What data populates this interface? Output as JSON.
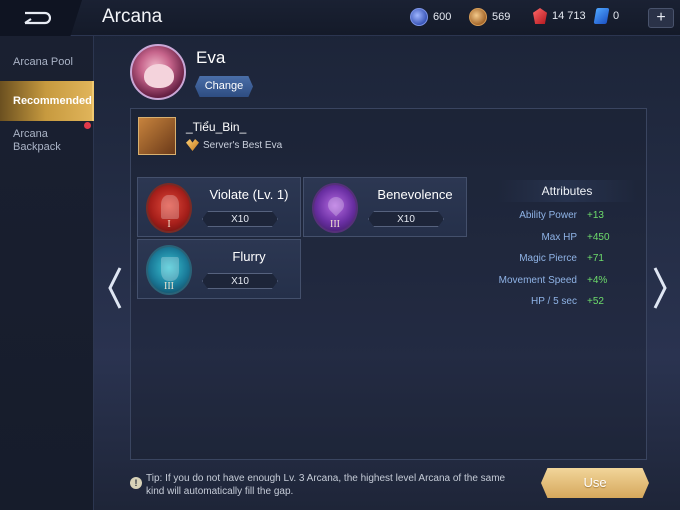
{
  "header": {
    "title": "Arcana",
    "back_icon": "back-arrow-icon",
    "currencies": [
      {
        "icon": "blue-coin-icon",
        "value": "600"
      },
      {
        "icon": "gold-coin-icon",
        "value": "569"
      },
      {
        "icon": "red-gem-icon",
        "value": "14 713"
      },
      {
        "icon": "voucher-icon",
        "value": "0"
      }
    ],
    "plus_label": "+"
  },
  "sidebar": {
    "items": [
      {
        "label": "Arcana Pool"
      },
      {
        "label": "Recommended"
      },
      {
        "label": "Arcana Backpack"
      }
    ]
  },
  "hero": {
    "name": "Eva",
    "change_label": "Change"
  },
  "player": {
    "name": "_Tiểu_Bin_",
    "title": "Server's Best Eva"
  },
  "arcana": [
    {
      "name": "Violate (Lv. 1)",
      "count": "X10",
      "level": "I",
      "color": "red"
    },
    {
      "name": "Benevolence",
      "count": "X10",
      "level": "III",
      "color": "purple"
    },
    {
      "name": "Flurry",
      "count": "X10",
      "level": "III",
      "color": "teal"
    }
  ],
  "attributes": {
    "title": "Attributes",
    "rows": [
      {
        "label": "Ability Power",
        "value": "+13"
      },
      {
        "label": "Max HP",
        "value": "+450"
      },
      {
        "label": "Magic Pierce",
        "value": "+71"
      },
      {
        "label": "Movement Speed",
        "value": "+4%"
      },
      {
        "label": "HP / 5 sec",
        "value": "+52"
      }
    ]
  },
  "footer": {
    "tip": "Tip: If you do not have enough Lv. 3 Arcana, the highest level Arcana of the same kind will automatically fill the gap.",
    "use_label": "Use",
    "tip_icon": "!"
  },
  "colors": {
    "accent_gold": "#d6a85c",
    "attr_label": "#8fb3e6",
    "attr_value": "#6ddc6b"
  }
}
